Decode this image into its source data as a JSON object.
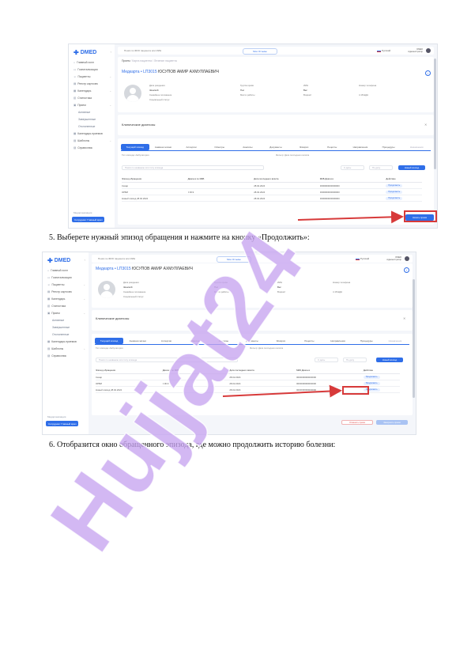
{
  "screenshot_1": {
    "logo": "DMED",
    "sidebar": {
      "items": [
        {
          "label": "Главный холл",
          "icon": "home-icon"
        },
        {
          "label": "Госпитализация",
          "icon": "bed-icon"
        },
        {
          "label": "Пациенты",
          "icon": "users-icon",
          "has_sub": true
        },
        {
          "label": "Реестр карточек",
          "icon": "file-icon"
        },
        {
          "label": "Календарь",
          "icon": "calendar-icon",
          "has_sub": true
        },
        {
          "label": "Статистика",
          "icon": "chart-icon"
        },
        {
          "label": "Прием",
          "icon": "clipboard-icon",
          "has_sub": true
        }
      ],
      "subitems": [
        "Активные",
        "Завершенные",
        "Отклоненные"
      ],
      "items_after": [
        {
          "label": "Календарь приемов",
          "icon": "calendar-icon"
        },
        {
          "label": "Шаблоны",
          "icon": "template-icon",
          "has_sub": true
        },
        {
          "label": "Справочник",
          "icon": "book-icon"
        }
      ],
      "footer_label": "Медорганизация",
      "footer_button": "Сотрудник: Главный врач"
    },
    "topbar": {
      "search_placeholder": "Поиск по ФИО пациента или ИИН",
      "center_button": "Мои Отзывы",
      "lang": "Русский",
      "user_line1": "DMED",
      "user_line2": "Администратор"
    },
    "breadcrumb": {
      "root": "Прием",
      "rest": "/ Карта пациента / Лечение пациента"
    },
    "patient_title": {
      "prefix": "Медкарта • LП3015",
      "name": "ЮСУПОВ АМИР АХМУЛЛАЕВИЧ"
    },
    "patient_fields": [
      [
        "Дата рождения",
        "Группа крови",
        "ИИН",
        "Номер телефона"
      ],
      [
        "Женский",
        "Пол",
        "Вес",
        ""
      ],
      [
        "Семейное положение",
        "Место работы",
        "Возраст",
        "4.18 ЕДН"
      ],
      [
        "Социальный статус",
        "",
        "",
        ""
      ]
    ],
    "section_title": "Клинические диагнозы",
    "tabs": [
      "Текущий эпизод",
      "Анамнез жизни",
      "Аллергии",
      "Осмотры",
      "Анализы",
      "Документы",
      "Эпикриз",
      "Рецепты",
      "Направления",
      "Процедуры",
      "Назначения"
    ],
    "filter_labels": {
      "left": "Тип эпизода: Амбулатория",
      "right": "Фильтр: Дата последнего визита"
    },
    "search_placeholder": "Поиск по названию или типу эпизода",
    "date_from": "С даты",
    "date_to": "По дату",
    "new_episode_button": "Новый эпизод",
    "table": {
      "headers": [
        "Эпизод обращения",
        "Диагноз по МКБ",
        "Дата последнего визита",
        "МКБ Диагноз",
        "Действие"
      ],
      "rows": [
        [
          "Сахар",
          "",
          "28.02.2024",
          "0000000000000000",
          "Продолжить"
        ],
        [
          "ОРВИ",
          "J 06.9",
          "28.02.2024",
          "0000000000000000",
          "Продолжить"
        ],
        [
          "Новый эпизод 28.02.2024",
          "",
          "28.02.2024",
          "0000000000000000",
          "Продолжить"
        ]
      ]
    },
    "continue_button": "Начать прием"
  },
  "step5_text": "5.   Выберете нужный эпизод обращения и нажмите на кнопку «Продолжить»:",
  "screenshot_2": {
    "cancel_button": "Отменить прием",
    "finish_button": "Завершить прием"
  },
  "step6_text": "6.   Отобразится окно обращенного эпизода, где можно продолжить историю болезни:",
  "watermark": "Hujjat24",
  "colors": {
    "accent": "#2f6ee8",
    "highlight": "#d73a3a",
    "watermark": "#c6a4f0"
  }
}
